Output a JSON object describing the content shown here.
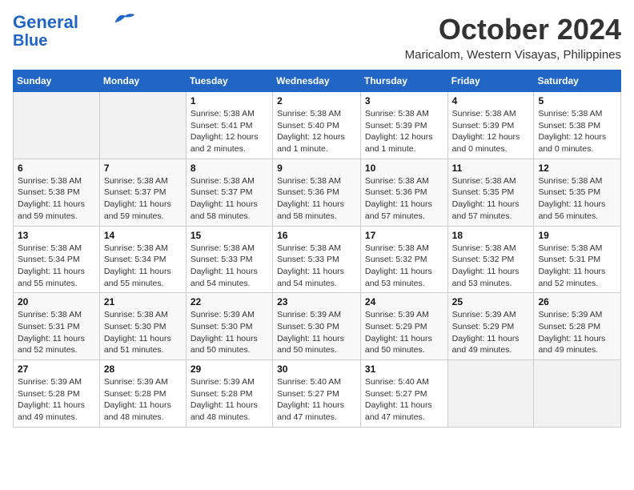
{
  "header": {
    "logo_line1": "General",
    "logo_line2": "Blue",
    "month": "October 2024",
    "location": "Maricalom, Western Visayas, Philippines"
  },
  "weekdays": [
    "Sunday",
    "Monday",
    "Tuesday",
    "Wednesday",
    "Thursday",
    "Friday",
    "Saturday"
  ],
  "weeks": [
    [
      {
        "day": "",
        "info": ""
      },
      {
        "day": "",
        "info": ""
      },
      {
        "day": "1",
        "info": "Sunrise: 5:38 AM\nSunset: 5:41 PM\nDaylight: 12 hours\nand 2 minutes."
      },
      {
        "day": "2",
        "info": "Sunrise: 5:38 AM\nSunset: 5:40 PM\nDaylight: 12 hours\nand 1 minute."
      },
      {
        "day": "3",
        "info": "Sunrise: 5:38 AM\nSunset: 5:39 PM\nDaylight: 12 hours\nand 1 minute."
      },
      {
        "day": "4",
        "info": "Sunrise: 5:38 AM\nSunset: 5:39 PM\nDaylight: 12 hours\nand 0 minutes."
      },
      {
        "day": "5",
        "info": "Sunrise: 5:38 AM\nSunset: 5:38 PM\nDaylight: 12 hours\nand 0 minutes."
      }
    ],
    [
      {
        "day": "6",
        "info": "Sunrise: 5:38 AM\nSunset: 5:38 PM\nDaylight: 11 hours\nand 59 minutes."
      },
      {
        "day": "7",
        "info": "Sunrise: 5:38 AM\nSunset: 5:37 PM\nDaylight: 11 hours\nand 59 minutes."
      },
      {
        "day": "8",
        "info": "Sunrise: 5:38 AM\nSunset: 5:37 PM\nDaylight: 11 hours\nand 58 minutes."
      },
      {
        "day": "9",
        "info": "Sunrise: 5:38 AM\nSunset: 5:36 PM\nDaylight: 11 hours\nand 58 minutes."
      },
      {
        "day": "10",
        "info": "Sunrise: 5:38 AM\nSunset: 5:36 PM\nDaylight: 11 hours\nand 57 minutes."
      },
      {
        "day": "11",
        "info": "Sunrise: 5:38 AM\nSunset: 5:35 PM\nDaylight: 11 hours\nand 57 minutes."
      },
      {
        "day": "12",
        "info": "Sunrise: 5:38 AM\nSunset: 5:35 PM\nDaylight: 11 hours\nand 56 minutes."
      }
    ],
    [
      {
        "day": "13",
        "info": "Sunrise: 5:38 AM\nSunset: 5:34 PM\nDaylight: 11 hours\nand 55 minutes."
      },
      {
        "day": "14",
        "info": "Sunrise: 5:38 AM\nSunset: 5:34 PM\nDaylight: 11 hours\nand 55 minutes."
      },
      {
        "day": "15",
        "info": "Sunrise: 5:38 AM\nSunset: 5:33 PM\nDaylight: 11 hours\nand 54 minutes."
      },
      {
        "day": "16",
        "info": "Sunrise: 5:38 AM\nSunset: 5:33 PM\nDaylight: 11 hours\nand 54 minutes."
      },
      {
        "day": "17",
        "info": "Sunrise: 5:38 AM\nSunset: 5:32 PM\nDaylight: 11 hours\nand 53 minutes."
      },
      {
        "day": "18",
        "info": "Sunrise: 5:38 AM\nSunset: 5:32 PM\nDaylight: 11 hours\nand 53 minutes."
      },
      {
        "day": "19",
        "info": "Sunrise: 5:38 AM\nSunset: 5:31 PM\nDaylight: 11 hours\nand 52 minutes."
      }
    ],
    [
      {
        "day": "20",
        "info": "Sunrise: 5:38 AM\nSunset: 5:31 PM\nDaylight: 11 hours\nand 52 minutes."
      },
      {
        "day": "21",
        "info": "Sunrise: 5:38 AM\nSunset: 5:30 PM\nDaylight: 11 hours\nand 51 minutes."
      },
      {
        "day": "22",
        "info": "Sunrise: 5:39 AM\nSunset: 5:30 PM\nDaylight: 11 hours\nand 50 minutes."
      },
      {
        "day": "23",
        "info": "Sunrise: 5:39 AM\nSunset: 5:30 PM\nDaylight: 11 hours\nand 50 minutes."
      },
      {
        "day": "24",
        "info": "Sunrise: 5:39 AM\nSunset: 5:29 PM\nDaylight: 11 hours\nand 50 minutes."
      },
      {
        "day": "25",
        "info": "Sunrise: 5:39 AM\nSunset: 5:29 PM\nDaylight: 11 hours\nand 49 minutes."
      },
      {
        "day": "26",
        "info": "Sunrise: 5:39 AM\nSunset: 5:28 PM\nDaylight: 11 hours\nand 49 minutes."
      }
    ],
    [
      {
        "day": "27",
        "info": "Sunrise: 5:39 AM\nSunset: 5:28 PM\nDaylight: 11 hours\nand 49 minutes."
      },
      {
        "day": "28",
        "info": "Sunrise: 5:39 AM\nSunset: 5:28 PM\nDaylight: 11 hours\nand 48 minutes."
      },
      {
        "day": "29",
        "info": "Sunrise: 5:39 AM\nSunset: 5:28 PM\nDaylight: 11 hours\nand 48 minutes."
      },
      {
        "day": "30",
        "info": "Sunrise: 5:40 AM\nSunset: 5:27 PM\nDaylight: 11 hours\nand 47 minutes."
      },
      {
        "day": "31",
        "info": "Sunrise: 5:40 AM\nSunset: 5:27 PM\nDaylight: 11 hours\nand 47 minutes."
      },
      {
        "day": "",
        "info": ""
      },
      {
        "day": "",
        "info": ""
      }
    ]
  ]
}
